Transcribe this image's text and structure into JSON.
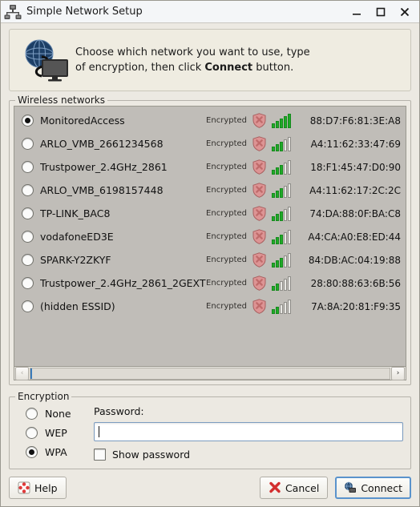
{
  "window": {
    "title": "Simple Network Setup",
    "icon": "network-topology-icon",
    "controls": {
      "minimize": "–",
      "maximize": "☐",
      "close": "✕"
    }
  },
  "banner": {
    "icon": "globe-monitor-icon",
    "line1": "Choose which network you want to use, type",
    "line2_before": "of encryption, then click ",
    "line2_bold": "Connect",
    "line2_after": " button."
  },
  "networks_group": {
    "title": "Wireless networks",
    "encrypted_label": "Encrypted",
    "shield_icon": "security-shield-icon",
    "rows": [
      {
        "ssid": "MonitoredAccess",
        "encrypted": "Encrypted",
        "signal": 5,
        "mac": "88:D7:F6:81:3E:A8",
        "selected": true
      },
      {
        "ssid": "ARLO_VMB_2661234568",
        "encrypted": "Encrypted",
        "signal": 3,
        "mac": "A4:11:62:33:47:69",
        "selected": false
      },
      {
        "ssid": "Trustpower_2.4GHz_2861",
        "encrypted": "Encrypted",
        "signal": 3,
        "mac": "18:F1:45:47:D0:90",
        "selected": false
      },
      {
        "ssid": "ARLO_VMB_6198157448",
        "encrypted": "Encrypted",
        "signal": 3,
        "mac": "A4:11:62:17:2C:2C",
        "selected": false
      },
      {
        "ssid": "TP-LINK_BAC8",
        "encrypted": "Encrypted",
        "signal": 3,
        "mac": "74:DA:88:0F:BA:C8",
        "selected": false
      },
      {
        "ssid": "vodafoneED3E",
        "encrypted": "Encrypted",
        "signal": 3,
        "mac": "A4:CA:A0:E8:ED:44",
        "selected": false
      },
      {
        "ssid": "SPARK-Y2ZKYF",
        "encrypted": "Encrypted",
        "signal": 3,
        "mac": "84:DB:AC:04:19:88",
        "selected": false
      },
      {
        "ssid": "Trustpower_2.4GHz_2861_2GEXT",
        "encrypted": "Encrypted",
        "signal": 2,
        "mac": "28:80:88:63:6B:56",
        "selected": false
      },
      {
        "ssid": "(hidden ESSID)",
        "encrypted": "Encrypted",
        "signal": 2,
        "mac": "7A:8A:20:81:F9:35",
        "selected": false
      }
    ],
    "scrollbar": {
      "left_arrow": "‹",
      "right_arrow": "›",
      "thumb_percent": 97
    }
  },
  "encryption_group": {
    "title": "Encryption",
    "options": [
      {
        "label": "None",
        "selected": false
      },
      {
        "label": "WEP",
        "selected": false
      },
      {
        "label": "WPA",
        "selected": true
      }
    ],
    "password_label": "Password:",
    "password_value": "",
    "password_placeholder": "",
    "show_password_label": "Show password",
    "show_password_checked": false
  },
  "footer": {
    "help_label": "Help",
    "help_icon": "help-icon",
    "cancel_label": "Cancel",
    "cancel_icon": "cancel-x-icon",
    "connect_label": "Connect",
    "connect_icon": "connect-globe-icon"
  },
  "colors": {
    "window_bg": "#ece9e2",
    "list_bg": "#c0bdb8",
    "signal_green": "#1faa27",
    "scroll_blue": "#4f94d6",
    "focus_blue": "#5a93cc",
    "shield_red": "#d98b8b"
  }
}
